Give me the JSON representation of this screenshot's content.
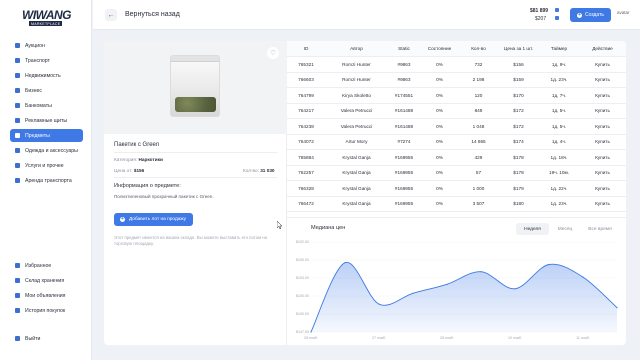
{
  "brand": {
    "name": "WIWANG",
    "tagline": "MARKETPLACE"
  },
  "sidebar": {
    "items": [
      {
        "label": "Аукцион",
        "icon": "gavel-icon",
        "active": false
      },
      {
        "label": "Транспорт",
        "icon": "car-icon",
        "active": false
      },
      {
        "label": "Недвижимость",
        "icon": "house-icon",
        "active": false
      },
      {
        "label": "Бизнес",
        "icon": "briefcase-icon",
        "active": false
      },
      {
        "label": "Банкоматы",
        "icon": "atm-icon",
        "active": false
      },
      {
        "label": "Рекламные щиты",
        "icon": "billboard-icon",
        "active": false
      },
      {
        "label": "Предметы",
        "icon": "box-icon",
        "active": true
      },
      {
        "label": "Одежда и аксессуары",
        "icon": "shirt-icon",
        "active": false
      },
      {
        "label": "Услуги и прочее",
        "icon": "tools-icon",
        "active": false
      },
      {
        "label": "Аренда транспорта",
        "icon": "key-icon",
        "active": false
      }
    ],
    "bottom_items": [
      {
        "label": "Избранное",
        "icon": "heart-icon"
      },
      {
        "label": "Склад хранения",
        "icon": "warehouse-icon"
      },
      {
        "label": "Мои объявления",
        "icon": "list-icon"
      },
      {
        "label": "История покупок",
        "icon": "history-icon"
      }
    ],
    "logout": {
      "label": "Выйти",
      "icon": "logout-icon"
    }
  },
  "header": {
    "back_label": "Вернуться назад",
    "balance_main": "$81 899",
    "balance_sub": "$207",
    "create_label": "Создать",
    "avatar_alt": "avatar"
  },
  "product": {
    "title": "Пакетик с Green",
    "category_label": "Категория:",
    "category_value": "Наркотики",
    "price_label": "Цена от:",
    "price_value": "$156",
    "qty_label": "Кол-во:",
    "qty_value": "31 030",
    "info_heading": "Информация о предмете:",
    "description": "Полиэтиленовый прозрачный пакетик с Green.",
    "add_lot_label": "Добавить лот на продажу",
    "note": "Этот предмет имеется на вашем складе. Вы можете выставить его потом на торговую площадку."
  },
  "table": {
    "columns": [
      "ID",
      "Автор",
      "Static",
      "Состояние",
      "Кол-во",
      "Цена за 1 шт.",
      "Таймер",
      "Действие"
    ],
    "rows": [
      [
        "765321",
        "Romzi Hunter",
        "#9863",
        "0%",
        "732",
        "$156",
        "1д. 9ч.",
        "Купить"
      ],
      [
        "766603",
        "Romzi Hunter",
        "#9863",
        "0%",
        "2 198",
        "$159",
        "1д. 23ч.",
        "Купить"
      ],
      [
        "764799",
        "Kirya Skoletto",
        "#174551",
        "0%",
        "120",
        "$170",
        "1д. 7ч.",
        "Купить"
      ],
      [
        "764217",
        "Valera Petrucci",
        "#161488",
        "0%",
        "849",
        "$172",
        "1д. 5ч.",
        "Купить"
      ],
      [
        "764238",
        "Valera Petrucci",
        "#161488",
        "0%",
        "1 048",
        "$172",
        "1д. 5ч.",
        "Купить"
      ],
      [
        "764072",
        "Artur Mory",
        "#7274",
        "0%",
        "14 865",
        "$174",
        "1д. 4ч.",
        "Купить"
      ],
      [
        "765884",
        "Krystal Ganja",
        "#169955",
        "0%",
        "429",
        "$178",
        "1д. 18ч.",
        "Купить"
      ],
      [
        "762257",
        "Krystal Ganja",
        "#169955",
        "0%",
        "57",
        "$178",
        "19ч. 10м.",
        "Купить"
      ],
      [
        "766328",
        "Krystal Ganja",
        "#169955",
        "0%",
        "1 000",
        "$179",
        "1д. 22ч.",
        "Купить"
      ],
      [
        "766472",
        "Krystal Ganja",
        "#169955",
        "0%",
        "3 507",
        "$180",
        "1д. 23ч.",
        "Купить"
      ]
    ]
  },
  "chart_section": {
    "title": "Медиана цен",
    "tabs": [
      {
        "label": "Неделя",
        "active": true
      },
      {
        "label": "Месяц",
        "active": false
      },
      {
        "label": "Все время",
        "active": false
      }
    ]
  },
  "chart_data": {
    "type": "area",
    "x": [
      "26 нояб.",
      "",
      "27 нояб.",
      "",
      "28 нояб.",
      "",
      "10 нояб.",
      "",
      "11 нояб.",
      ""
    ],
    "yticks": [
      "$152.50",
      "$155.00",
      "$153.00",
      "$150.00",
      "$150.00",
      "$147.50"
    ],
    "values": [
      147.5,
      155.2,
      150.6,
      151.8,
      152.8,
      154.2,
      152.3,
      155.0,
      153.6,
      150.2
    ],
    "ylim": [
      147.5,
      157.5
    ],
    "color": "#3e79e5"
  }
}
